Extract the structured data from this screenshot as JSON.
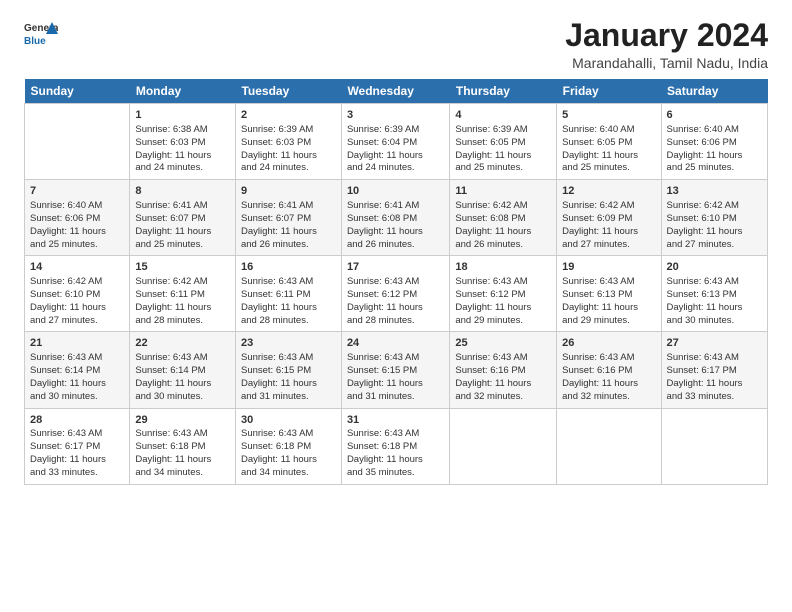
{
  "logo": {
    "line1": "General",
    "line2": "Blue"
  },
  "title": "January 2024",
  "subtitle": "Marandahalli, Tamil Nadu, India",
  "header": {
    "accent_color": "#2c6fad"
  },
  "weekdays": [
    "Sunday",
    "Monday",
    "Tuesday",
    "Wednesday",
    "Thursday",
    "Friday",
    "Saturday"
  ],
  "weeks": [
    [
      {
        "day": "",
        "info": ""
      },
      {
        "day": "1",
        "info": "Sunrise: 6:38 AM\nSunset: 6:03 PM\nDaylight: 11 hours\nand 24 minutes."
      },
      {
        "day": "2",
        "info": "Sunrise: 6:39 AM\nSunset: 6:03 PM\nDaylight: 11 hours\nand 24 minutes."
      },
      {
        "day": "3",
        "info": "Sunrise: 6:39 AM\nSunset: 6:04 PM\nDaylight: 11 hours\nand 24 minutes."
      },
      {
        "day": "4",
        "info": "Sunrise: 6:39 AM\nSunset: 6:05 PM\nDaylight: 11 hours\nand 25 minutes."
      },
      {
        "day": "5",
        "info": "Sunrise: 6:40 AM\nSunset: 6:05 PM\nDaylight: 11 hours\nand 25 minutes."
      },
      {
        "day": "6",
        "info": "Sunrise: 6:40 AM\nSunset: 6:06 PM\nDaylight: 11 hours\nand 25 minutes."
      }
    ],
    [
      {
        "day": "7",
        "info": "Sunrise: 6:40 AM\nSunset: 6:06 PM\nDaylight: 11 hours\nand 25 minutes."
      },
      {
        "day": "8",
        "info": "Sunrise: 6:41 AM\nSunset: 6:07 PM\nDaylight: 11 hours\nand 25 minutes."
      },
      {
        "day": "9",
        "info": "Sunrise: 6:41 AM\nSunset: 6:07 PM\nDaylight: 11 hours\nand 26 minutes."
      },
      {
        "day": "10",
        "info": "Sunrise: 6:41 AM\nSunset: 6:08 PM\nDaylight: 11 hours\nand 26 minutes."
      },
      {
        "day": "11",
        "info": "Sunrise: 6:42 AM\nSunset: 6:08 PM\nDaylight: 11 hours\nand 26 minutes."
      },
      {
        "day": "12",
        "info": "Sunrise: 6:42 AM\nSunset: 6:09 PM\nDaylight: 11 hours\nand 27 minutes."
      },
      {
        "day": "13",
        "info": "Sunrise: 6:42 AM\nSunset: 6:10 PM\nDaylight: 11 hours\nand 27 minutes."
      }
    ],
    [
      {
        "day": "14",
        "info": "Sunrise: 6:42 AM\nSunset: 6:10 PM\nDaylight: 11 hours\nand 27 minutes."
      },
      {
        "day": "15",
        "info": "Sunrise: 6:42 AM\nSunset: 6:11 PM\nDaylight: 11 hours\nand 28 minutes."
      },
      {
        "day": "16",
        "info": "Sunrise: 6:43 AM\nSunset: 6:11 PM\nDaylight: 11 hours\nand 28 minutes."
      },
      {
        "day": "17",
        "info": "Sunrise: 6:43 AM\nSunset: 6:12 PM\nDaylight: 11 hours\nand 28 minutes."
      },
      {
        "day": "18",
        "info": "Sunrise: 6:43 AM\nSunset: 6:12 PM\nDaylight: 11 hours\nand 29 minutes."
      },
      {
        "day": "19",
        "info": "Sunrise: 6:43 AM\nSunset: 6:13 PM\nDaylight: 11 hours\nand 29 minutes."
      },
      {
        "day": "20",
        "info": "Sunrise: 6:43 AM\nSunset: 6:13 PM\nDaylight: 11 hours\nand 30 minutes."
      }
    ],
    [
      {
        "day": "21",
        "info": "Sunrise: 6:43 AM\nSunset: 6:14 PM\nDaylight: 11 hours\nand 30 minutes."
      },
      {
        "day": "22",
        "info": "Sunrise: 6:43 AM\nSunset: 6:14 PM\nDaylight: 11 hours\nand 30 minutes."
      },
      {
        "day": "23",
        "info": "Sunrise: 6:43 AM\nSunset: 6:15 PM\nDaylight: 11 hours\nand 31 minutes."
      },
      {
        "day": "24",
        "info": "Sunrise: 6:43 AM\nSunset: 6:15 PM\nDaylight: 11 hours\nand 31 minutes."
      },
      {
        "day": "25",
        "info": "Sunrise: 6:43 AM\nSunset: 6:16 PM\nDaylight: 11 hours\nand 32 minutes."
      },
      {
        "day": "26",
        "info": "Sunrise: 6:43 AM\nSunset: 6:16 PM\nDaylight: 11 hours\nand 32 minutes."
      },
      {
        "day": "27",
        "info": "Sunrise: 6:43 AM\nSunset: 6:17 PM\nDaylight: 11 hours\nand 33 minutes."
      }
    ],
    [
      {
        "day": "28",
        "info": "Sunrise: 6:43 AM\nSunset: 6:17 PM\nDaylight: 11 hours\nand 33 minutes."
      },
      {
        "day": "29",
        "info": "Sunrise: 6:43 AM\nSunset: 6:18 PM\nDaylight: 11 hours\nand 34 minutes."
      },
      {
        "day": "30",
        "info": "Sunrise: 6:43 AM\nSunset: 6:18 PM\nDaylight: 11 hours\nand 34 minutes."
      },
      {
        "day": "31",
        "info": "Sunrise: 6:43 AM\nSunset: 6:18 PM\nDaylight: 11 hours\nand 35 minutes."
      },
      {
        "day": "",
        "info": ""
      },
      {
        "day": "",
        "info": ""
      },
      {
        "day": "",
        "info": ""
      }
    ]
  ]
}
